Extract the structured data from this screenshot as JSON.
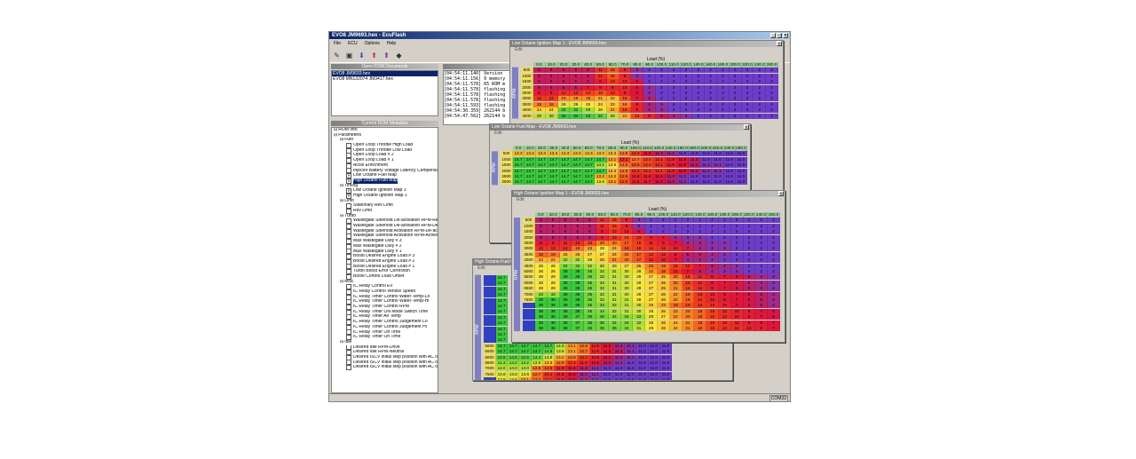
{
  "app": {
    "title": "EVO8 JM9693.hex - EcuFlash"
  },
  "menu": [
    "File",
    "ECU",
    "Options",
    "Help"
  ],
  "open_roms": {
    "header": "Open ROM Documents",
    "items": [
      "EVO8 JM9693.hex",
      "EVO8 MN132074 JM3417.hex"
    ]
  },
  "metadata_header": "Current ROM Metadata",
  "tree": [
    {
      "label": "ROM Info",
      "level": 0,
      "type": "node"
    },
    {
      "label": "Parameters",
      "level": 0,
      "type": "node"
    },
    {
      "label": "Fuel",
      "level": 1,
      "type": "node"
    },
    {
      "label": "Open Loop Throttle High Load",
      "level": 2,
      "type": "leaf"
    },
    {
      "label": "Open Loop Throttle Low Load",
      "level": 2,
      "type": "leaf"
    },
    {
      "label": "Open Loop Load # 2",
      "level": 2,
      "type": "leaf"
    },
    {
      "label": "Open Loop Load # 1",
      "level": 2,
      "type": "leaf"
    },
    {
      "label": "Accel Enrichment",
      "level": 2,
      "type": "leaf"
    },
    {
      "label": "Injector Battery Voltage Latency Compensation",
      "level": 2,
      "type": "leaf"
    },
    {
      "label": "Low Octane Fuel Map",
      "level": 2,
      "type": "leaf",
      "checked": true
    },
    {
      "label": "High Octane Fuel Map",
      "level": 2,
      "type": "leaf",
      "checked": true,
      "selected": true
    },
    {
      "label": "Timing",
      "level": 1,
      "type": "node"
    },
    {
      "label": "Low Octane Ignition Map 1",
      "level": 2,
      "type": "leaf",
      "checked": true
    },
    {
      "label": "High Octane Ignition Map 1",
      "level": 2,
      "type": "leaf",
      "checked": true
    },
    {
      "label": "Limit",
      "level": 1,
      "type": "node"
    },
    {
      "label": "Stationary Rev Limit",
      "level": 2,
      "type": "leaf"
    },
    {
      "label": "Rev Limit",
      "level": 2,
      "type": "leaf"
    },
    {
      "label": "Turbo",
      "level": 1,
      "type": "node"
    },
    {
      "label": "Wastegate Solenoid De-activation RPM-Re-activ...",
      "level": 2,
      "type": "leaf"
    },
    {
      "label": "Wastegate Solenoid De-activation RPM-De-activ...",
      "level": 2,
      "type": "leaf"
    },
    {
      "label": "Wastegate Solenoid Activation RPM-De-activate",
      "level": 2,
      "type": "leaf"
    },
    {
      "label": "Wastegate Solenoid Activation RPM-Active",
      "level": 2,
      "type": "leaf"
    },
    {
      "label": "Max Wastegate Duty # 3",
      "level": 2,
      "type": "leaf"
    },
    {
      "label": "Max Wastegate Duty # 2",
      "level": 2,
      "type": "leaf"
    },
    {
      "label": "Max Wastegate Duty # 1",
      "level": 2,
      "type": "leaf"
    },
    {
      "label": "Boost Desired Engine Load # 3",
      "level": 2,
      "type": "leaf"
    },
    {
      "label": "Boost Desired Engine Load # 2",
      "level": 2,
      "type": "leaf"
    },
    {
      "label": "Boost Desired Engine Load # 1",
      "level": 2,
      "type": "leaf"
    },
    {
      "label": "Turbo Boost Error Correction",
      "level": 2,
      "type": "leaf"
    },
    {
      "label": "Boost Control Load Offset",
      "level": 2,
      "type": "leaf"
    },
    {
      "label": "Misc",
      "level": 1,
      "type": "node"
    },
    {
      "label": "IC Relay Control EV",
      "level": 2,
      "type": "leaf"
    },
    {
      "label": "IC Relay Control Vehicle Speed",
      "level": 2,
      "type": "leaf"
    },
    {
      "label": "IC Relay Timer Control Water-Temp-Lo",
      "level": 2,
      "type": "leaf"
    },
    {
      "label": "IC Relay Timer Control Water-Temp-Hi",
      "level": 2,
      "type": "leaf"
    },
    {
      "label": "IC Relay Timer Control RPM",
      "level": 2,
      "type": "leaf"
    },
    {
      "label": "IC Relay Timer ON Mode Switch Time",
      "level": 2,
      "type": "leaf"
    },
    {
      "label": "IC Relay Timer Air Temp",
      "level": 2,
      "type": "leaf"
    },
    {
      "label": "IC Relay Timer Control Judgement Lo",
      "level": 2,
      "type": "leaf"
    },
    {
      "label": "IC Relay Timer Control Judgement Hi",
      "level": 2,
      "type": "leaf"
    },
    {
      "label": "IC Relay Timer Off Time",
      "level": 2,
      "type": "leaf"
    },
    {
      "label": "IC Relay Timer On Time",
      "level": 2,
      "type": "leaf"
    },
    {
      "label": "Idle",
      "level": 1,
      "type": "node"
    },
    {
      "label": "Desired Idle RPM-Drive",
      "level": 2,
      "type": "leaf"
    },
    {
      "label": "Desired Idle RPM-Neutral",
      "level": 2,
      "type": "leaf"
    },
    {
      "label": "Desired ISCV initial step position with AC on-Neutral",
      "level": 2,
      "type": "leaf"
    },
    {
      "label": "Desired ISCV initial step position with AC off-Drive",
      "level": 2,
      "type": "leaf"
    },
    {
      "label": "Desired ISCV initial step position with AC off-Neutral",
      "level": 2,
      "type": "leaf"
    }
  ],
  "log": [
    "[04:54:11.140] Version",
    "[04:54:11.156] 9 memory",
    "[04:54:11.578] 65 ROM m",
    "[04:54:11.578] flashing",
    "[04:54:11.578] flashing",
    "[04:54:11.578] flashing",
    "[04:54:11.593] flashing",
    "[04:54:30.359] 262144 b",
    "[04:54:47.562] 262144 b"
  ],
  "status": {
    "port": "COM32"
  },
  "colors": {
    "accent": "#0a246a",
    "axis": "#a0d0a0"
  },
  "windows": {
    "low_ign": {
      "title": "Low Octane Ignition Map 1 - EVO8 JM9693.hex",
      "edit": "Edit",
      "xlabel": "Load (%)",
      "ylabel": "RPM"
    },
    "low_fuel": {
      "title": "Low Octane Fuel Map - EVO8 JM9693.hex",
      "edit": "Edit",
      "xlabel": "Load (%)",
      "ylabel": "RPM"
    },
    "high_ign": {
      "title": "High Octane Ignition Map 1 - EVO8 JM9693.hex",
      "edit": "Edit",
      "xlabel": "Load (%)",
      "ylabel": "RPM"
    },
    "high_fuel": {
      "title": "High Octane Fuel M",
      "edit": "Edit",
      "ylabel": "RPM"
    }
  },
  "load_axis": [
    "0.0",
    "10.0",
    "20.0",
    "30.0",
    "40.0",
    "50.0",
    "60.0",
    "70.0",
    "80.0",
    "90.0",
    "100.0",
    "110.0",
    "120.0",
    "140.0",
    "160.0",
    "180.0",
    "200.0",
    "220.0",
    "240.0",
    "260.0"
  ],
  "rpm_axis": [
    "500",
    "1000",
    "1500",
    "2000",
    "2500",
    "3000",
    "3500",
    "4000",
    "4500",
    "5000",
    "5500",
    "6000",
    "6500",
    "7000",
    "7500"
  ],
  "high_ign_rows": [
    [
      "5",
      "5",
      "5",
      "5",
      "5",
      "11",
      "15",
      "9",
      "3",
      "2",
      "2",
      "2",
      "2",
      "2",
      "2",
      "2",
      "2",
      "2",
      "2",
      "2"
    ],
    [
      "5",
      "5",
      "5",
      "5",
      "5",
      "11",
      "15",
      "9",
      "3",
      "2",
      "2",
      "2",
      "2",
      "2",
      "2",
      "2",
      "2",
      "2",
      "2",
      "2"
    ],
    [
      "5",
      "5",
      "5",
      "5",
      "5",
      "8",
      "13",
      "10",
      "6",
      "2",
      "2",
      "2",
      "2",
      "2",
      "2",
      "2",
      "2",
      "2",
      "2",
      "2"
    ],
    [
      "5",
      "5",
      "5",
      "5",
      "5",
      "9",
      "13",
      "16",
      "13",
      "9",
      "7",
      "4",
      "3",
      "3",
      "2",
      "2",
      "2",
      "2",
      "2",
      "2"
    ],
    [
      "8",
      "9",
      "11",
      "12",
      "16",
      "20",
      "20",
      "17",
      "15",
      "11",
      "9",
      "7",
      "4",
      "4",
      "3",
      "3",
      "2",
      "2",
      "2",
      "2"
    ],
    [
      "13",
      "13",
      "13",
      "19",
      "23",
      "28",
      "24",
      "16",
      "15",
      "14",
      "12",
      "10",
      "7",
      "4",
      "3",
      "3",
      "2",
      "2",
      "2",
      "2"
    ],
    [
      "18",
      "19",
      "25",
      "25",
      "27",
      "27",
      "24",
      "20",
      "17",
      "14",
      "11",
      "8",
      "5",
      "5",
      "4",
      "3",
      "2",
      "2",
      "2",
      "2"
    ],
    [
      "24",
      "24",
      "32",
      "32",
      "29",
      "26",
      "21",
      "20",
      "17",
      "12",
      "10",
      "7",
      "4",
      "4",
      "3",
      "2",
      "2",
      "2",
      "2",
      "2"
    ],
    [
      "28",
      "28",
      "34",
      "34",
      "32",
      "30",
      "29",
      "27",
      "25",
      "20",
      "19",
      "15",
      "12",
      "7",
      "5",
      "4",
      "3",
      "2",
      "2",
      "2"
    ],
    [
      "28",
      "28",
      "38",
      "38",
      "35",
      "32",
      "31",
      "30",
      "29",
      "22",
      "18",
      "12",
      "7",
      "5",
      "4",
      "3",
      "3",
      "2",
      "2",
      "2"
    ],
    [
      "28",
      "28",
      "38",
      "38",
      "35",
      "32",
      "31",
      "30",
      "28",
      "27",
      "25",
      "20",
      "15",
      "11",
      "8",
      "7",
      "6",
      "5",
      "4",
      "3"
    ],
    [
      "28",
      "28",
      "38",
      "38",
      "35",
      "32",
      "31",
      "30",
      "28",
      "27",
      "25",
      "20",
      "15",
      "11",
      "8",
      "7",
      "6",
      "5",
      "4",
      "3"
    ],
    [
      "28",
      "28",
      "38",
      "38",
      "35",
      "32",
      "31",
      "30",
      "28",
      "27",
      "25",
      "21",
      "16",
      "12",
      "9",
      "7",
      "6",
      "5",
      "4",
      "3"
    ],
    [
      "33",
      "33",
      "38",
      "38",
      "35",
      "32",
      "31",
      "30",
      "28",
      "27",
      "26",
      "22",
      "18",
      "13",
      "10",
      "8",
      "7",
      "6",
      "5",
      "4"
    ],
    [
      "38",
      "38",
      "38",
      "38",
      "35",
      "32",
      "31",
      "31",
      "28",
      "27",
      "26",
      "22",
      "18",
      "14",
      "10",
      "8",
      "7",
      "6",
      "5",
      "4"
    ],
    [
      "38",
      "38",
      "38",
      "38",
      "35",
      "34",
      "32",
      "31",
      "30",
      "26",
      "23",
      "18",
      "16",
      "14",
      "13",
      "10",
      "7",
      "6",
      "5",
      "4"
    ],
    [
      "38",
      "38",
      "38",
      "38",
      "35",
      "34",
      "32",
      "31",
      "30",
      "28",
      "26",
      "22",
      "20",
      "18",
      "15",
      "12",
      "10",
      "8",
      "7",
      "6"
    ],
    [
      "38",
      "38",
      "38",
      "37",
      "36",
      "35",
      "34",
      "34",
      "33",
      "29",
      "27",
      "22",
      "20",
      "18",
      "15",
      "12",
      "10",
      "8",
      "7",
      "6"
    ],
    [
      "38",
      "38",
      "38",
      "37",
      "36",
      "35",
      "34",
      "34",
      "32",
      "28",
      "26",
      "24",
      "21",
      "18",
      "15",
      "13",
      "11",
      "9",
      "8",
      "7"
    ],
    [
      "38",
      "38",
      "38",
      "37",
      "36",
      "35",
      "35",
      "34",
      "31",
      "28",
      "26",
      "24",
      "21",
      "18",
      "15",
      "13",
      "12",
      "10",
      "9",
      "7"
    ]
  ],
  "low_fuel_rows": [
    [
      "13.3",
      "13.3",
      "13.3",
      "13.3",
      "13.3",
      "13.3",
      "13.3",
      "13.3",
      "13.3",
      "12.8",
      "12.3",
      "11.6",
      "11.3",
      "11.2",
      "11.0",
      "11.0",
      "11.0",
      "11.0",
      "11.0",
      "11.0"
    ],
    [
      "14.7",
      "14.7",
      "14.7",
      "14.7",
      "14.7",
      "14.7",
      "14.7",
      "14.7",
      "13.1",
      "12.1",
      "12.7",
      "12.4",
      "12.1",
      "11.8",
      "11.5",
      "11.3",
      "11.0",
      "11.0",
      "11.0",
      "11.0"
    ],
    [
      "14.7",
      "14.7",
      "14.7",
      "14.7",
      "14.7",
      "14.7",
      "14.7",
      "14.1",
      "13.6",
      "12.8",
      "12.5",
      "12.4",
      "12.1",
      "11.8",
      "11.5",
      "11.3",
      "11.1",
      "11.1",
      "11.0",
      "11.0"
    ],
    [
      "14.7",
      "14.7",
      "14.7",
      "14.7",
      "14.7",
      "14.7",
      "14.7",
      "14.7",
      "13.3",
      "12.8",
      "12.2",
      "12.2",
      "12.1",
      "11.8",
      "11.5",
      "11.3",
      "11.1",
      "11.1",
      "11.0",
      "11.0"
    ],
    [
      "14.7",
      "14.7",
      "14.7",
      "14.7",
      "14.7",
      "14.7",
      "14.7",
      "13.2",
      "13.2",
      "12.6",
      "11.8",
      "11.8",
      "11.5",
      "11.3",
      "11.1",
      "11.0",
      "11.0",
      "11.0",
      "11.0",
      "11.0"
    ],
    [
      "14.7",
      "14.7",
      "14.7",
      "14.7",
      "14.7",
      "14.7",
      "14.7",
      "13.8",
      "13.1",
      "12.5",
      "11.8",
      "11.7",
      "11.4",
      "11.3",
      "11.1",
      "11.0",
      "11.0",
      "11.0",
      "11.0",
      "11.0"
    ]
  ],
  "low_ign_rows": [
    [
      "5",
      "5",
      "5",
      "5",
      "5",
      "11",
      "15",
      "9",
      "3",
      "2",
      "2",
      "2",
      "2",
      "2",
      "2",
      "2",
      "2",
      "2",
      "2",
      "2"
    ],
    [
      "5",
      "5",
      "5",
      "5",
      "5",
      "11",
      "15",
      "9",
      "3",
      "2",
      "2",
      "2",
      "2",
      "2",
      "2",
      "2",
      "2",
      "2",
      "2",
      "2"
    ],
    [
      "5",
      "5",
      "5",
      "5",
      "5",
      "8",
      "13",
      "10",
      "6",
      "2",
      "2",
      "2",
      "2",
      "2",
      "2",
      "2",
      "2",
      "2",
      "2",
      "2"
    ],
    [
      "5",
      "5",
      "5",
      "5",
      "7",
      "9",
      "9",
      "10",
      "6",
      "3",
      "2",
      "2",
      "2",
      "2",
      "2",
      "2",
      "2",
      "2",
      "2",
      "2"
    ],
    [
      "8",
      "8",
      "12",
      "12",
      "14",
      "15",
      "13",
      "9",
      "6",
      "3",
      "2",
      "2",
      "2",
      "2",
      "2",
      "2",
      "2",
      "2",
      "2",
      "2"
    ],
    [
      "13",
      "13",
      "19",
      "19",
      "19",
      "21",
      "22",
      "15",
      "7",
      "4",
      "2",
      "2",
      "2",
      "2",
      "2",
      "2",
      "2",
      "2",
      "2",
      "2"
    ],
    [
      "18",
      "18",
      "26",
      "26",
      "25",
      "24",
      "23",
      "18",
      "9",
      "4",
      "3",
      "2",
      "2",
      "2",
      "2",
      "2",
      "2",
      "2",
      "2",
      "2"
    ],
    [
      "24",
      "24",
      "32",
      "32",
      "29",
      "26",
      "21",
      "14",
      "9",
      "4",
      "3",
      "2",
      "2",
      "2",
      "2",
      "2",
      "2",
      "2",
      "2",
      "2"
    ],
    [
      "28",
      "28",
      "34",
      "34",
      "33",
      "32",
      "28",
      "21",
      "14",
      "9",
      "5",
      "4",
      "3",
      "2",
      "2",
      "2",
      "2",
      "2",
      "2",
      "2"
    ]
  ],
  "high_fuel_rows": [
    [
      "14.7"
    ],
    [
      "14.7"
    ],
    [
      "14.7"
    ],
    [
      "14.7"
    ],
    [
      "14.7"
    ],
    [
      "14.7"
    ],
    [
      "14.7"
    ],
    [
      "14.7"
    ],
    [
      "14.7"
    ],
    [
      "14.7"
    ],
    [
      "14.7"
    ],
    [
      "14.7"
    ],
    [
      "14.7",
      "14.7",
      "14.7",
      "14.7",
      "14.7",
      "14.0",
      "13.1",
      "12.8",
      "11.9",
      "11.5",
      "11.2",
      "11.1",
      "11.0",
      "11.0",
      "11.0"
    ],
    [
      "14.7",
      "14.7",
      "14.7",
      "14.7",
      "14.5",
      "13.9",
      "13.1",
      "12.7",
      "11.9",
      "11.6",
      "11.3",
      "11.1",
      "11.0",
      "11.0",
      "11.0"
    ],
    [
      "14.5",
      "14.5",
      "14.5",
      "14.4",
      "13.9",
      "13.2",
      "12.8",
      "12.2",
      "11.8",
      "11.4",
      "11.2",
      "11.1",
      "11.0",
      "11.0",
      "11.0"
    ],
    [
      "14.2",
      "14.2",
      "14.2",
      "13.9",
      "13.3",
      "12.8",
      "12.3",
      "11.9",
      "11.6",
      "11.3",
      "11.1",
      "11.0",
      "11.0",
      "11.0",
      "11.0"
    ],
    [
      "14.0",
      "14.0",
      "14.0",
      "12.8",
      "12.5",
      "11.9",
      "11.6",
      "11.3",
      "11.1",
      "11.0",
      "11.0",
      "11.0",
      "11.0",
      "11.0",
      "11.0"
    ],
    [
      "13.8",
      "13.8",
      "13.8",
      "12.7",
      "12.1",
      "11.8",
      "11.5",
      "11.2",
      "11.1",
      "11.0",
      "11.0",
      "11.0",
      "11.0",
      "11.0",
      "11.0"
    ],
    [
      "13.8",
      "13.8",
      "13.1",
      "12.7",
      "12.1",
      "11.8",
      "11.5",
      "11.2",
      "11.1",
      "11.0",
      "11.0",
      "11.0",
      "11.0",
      "11.0",
      "11.0"
    ]
  ],
  "high_fuel_rpm": [
    "",
    "",
    "",
    "",
    "",
    "",
    "",
    "",
    "",
    "",
    "",
    "",
    "5000",
    "5500",
    "6000",
    "6500",
    "7000",
    "7500"
  ]
}
